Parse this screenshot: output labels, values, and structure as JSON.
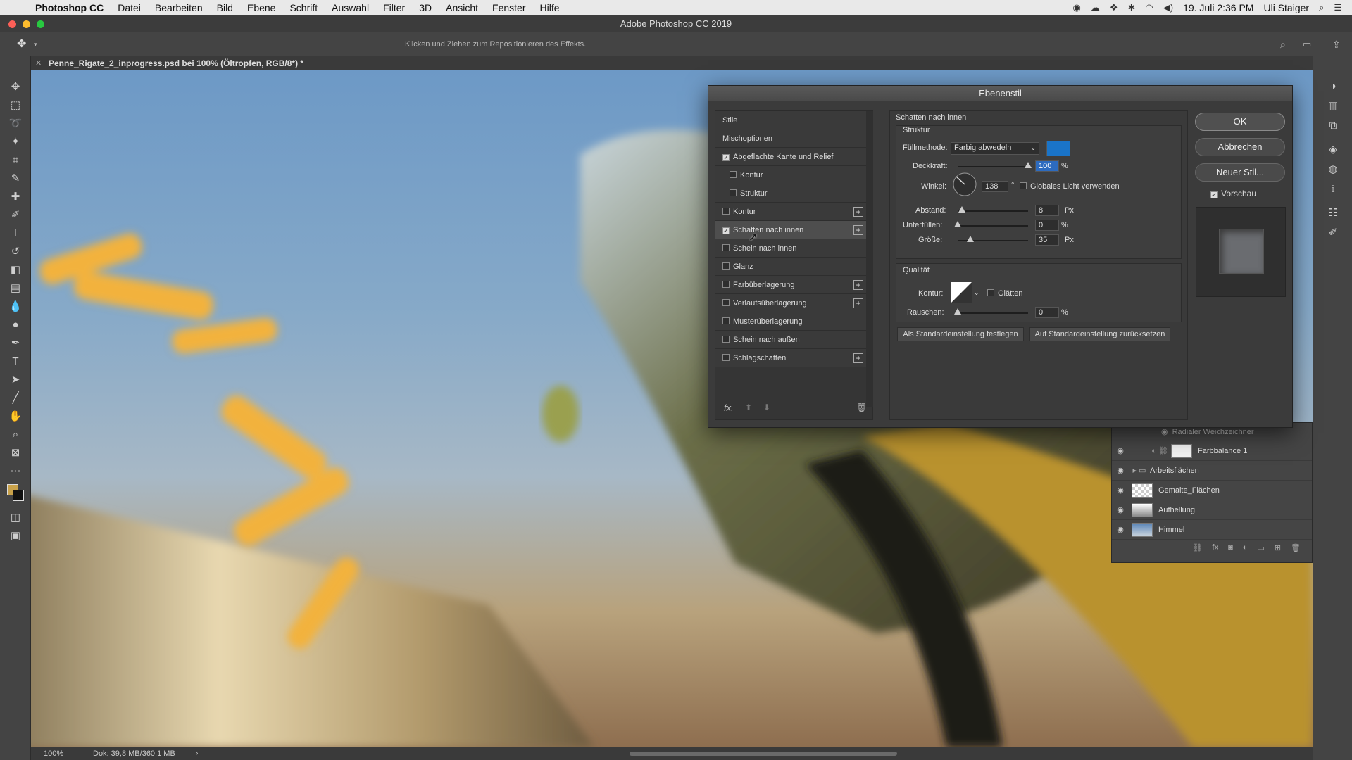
{
  "menubar": {
    "app": "Photoshop CC",
    "items": [
      "Datei",
      "Bearbeiten",
      "Bild",
      "Ebene",
      "Schrift",
      "Auswahl",
      "Filter",
      "3D",
      "Ansicht",
      "Fenster",
      "Hilfe"
    ],
    "datetime": "19. Juli  2:36 PM",
    "user": "Uli Staiger"
  },
  "window": {
    "title": "Adobe Photoshop CC 2019"
  },
  "options": {
    "hint": "Klicken und Ziehen zum Repositionieren des Effekts."
  },
  "document": {
    "tab": "Penne_Rigate_2_inprogress.psd bei 100% (Öltropfen, RGB/8*) *"
  },
  "status": {
    "zoom": "100%",
    "doc": "Dok: 39,8 MB/360,1 MB"
  },
  "dialog": {
    "title": "Ebenenstil",
    "styles": [
      {
        "label": "Stile",
        "type": "header"
      },
      {
        "label": "Mischoptionen",
        "type": "header"
      },
      {
        "label": "Abgeflachte Kante und Relief",
        "checked": true
      },
      {
        "label": "Kontur",
        "checked": false,
        "sub": true
      },
      {
        "label": "Struktur",
        "checked": false,
        "sub": true
      },
      {
        "label": "Kontur",
        "checked": false,
        "plus": true
      },
      {
        "label": "Schatten nach innen",
        "checked": true,
        "plus": true,
        "selected": true
      },
      {
        "label": "Schein nach innen",
        "checked": false
      },
      {
        "label": "Glanz",
        "checked": false
      },
      {
        "label": "Farbüberlagerung",
        "checked": false,
        "plus": true
      },
      {
        "label": "Verlaufsüberlagerung",
        "checked": false,
        "plus": true
      },
      {
        "label": "Musterüberlagerung",
        "checked": false
      },
      {
        "label": "Schein nach außen",
        "checked": false
      },
      {
        "label": "Schlagschatten",
        "checked": false,
        "plus": true
      }
    ],
    "panel_title": "Schatten nach innen",
    "structure_title": "Struktur",
    "blend_label": "Füllmethode:",
    "blend_value": "Farbig abwedeln",
    "blend_color": "#1a74c8",
    "opacity_label": "Deckkraft:",
    "opacity_value": "100",
    "opacity_unit": "%",
    "opacity_level": 1.0,
    "angle_label": "Winkel:",
    "angle_value": "138",
    "angle_unit": "°",
    "global_light_label": "Globales Licht verwenden",
    "distance_label": "Abstand:",
    "distance_value": "8",
    "distance_unit": "Px",
    "choke_label": "Unterfüllen:",
    "choke_value": "0",
    "choke_unit": "%",
    "size_label": "Größe:",
    "size_value": "35",
    "size_unit": "Px",
    "quality_title": "Qualität",
    "contour_label": "Kontur:",
    "antialias_label": "Glätten",
    "noise_label": "Rauschen:",
    "noise_value": "0",
    "noise_unit": "%",
    "make_default": "Als Standardeinstellung festlegen",
    "reset_default": "Auf Standardeinstellung zurücksetzen",
    "ok": "OK",
    "cancel": "Abbrechen",
    "new_style": "Neuer Stil...",
    "preview": "Vorschau"
  },
  "layers": {
    "filter_item": "Radialer Weichzeichner",
    "rows": [
      "Farbbalance 1",
      "Arbeitsflächen",
      "Gemalte_Flächen",
      "Aufhellung",
      "Himmel"
    ]
  },
  "colors": {
    "accent": "#1a74c8",
    "dialog_bg": "#3b3b3b"
  }
}
